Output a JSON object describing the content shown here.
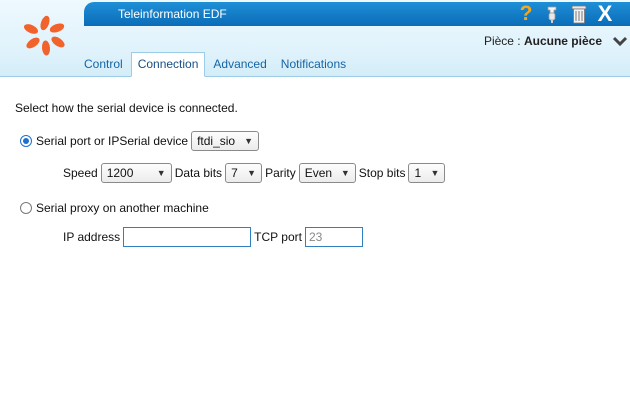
{
  "window": {
    "title": "Teleinformation EDF",
    "icons": [
      "help-icon",
      "plugin-icon",
      "trash-icon",
      "close-icon"
    ],
    "help_glyph": "?",
    "close_glyph": "X"
  },
  "room": {
    "label": "Pièce :",
    "value": "Aucune pièce"
  },
  "tabs": [
    {
      "label": "Control",
      "active": false
    },
    {
      "label": "Connection",
      "active": true
    },
    {
      "label": "Advanced",
      "active": false
    },
    {
      "label": "Notifications",
      "active": false
    }
  ],
  "connection": {
    "intro": "Select how the serial device is connected.",
    "serial": {
      "label": "Serial port or IPSerial device",
      "selected": true,
      "device": "ftdi_sio",
      "speed_label": "Speed",
      "speed": "1200",
      "databits_label": "Data bits",
      "databits": "7",
      "parity_label": "Parity",
      "parity": "Even",
      "stopbits_label": "Stop bits",
      "stopbits": "1"
    },
    "proxy": {
      "label": "Serial proxy on another machine",
      "selected": false,
      "ip_label": "IP address",
      "ip_value": "",
      "port_label": "TCP port",
      "port_placeholder": "23"
    }
  },
  "colors": {
    "accent": "#0b6cb8",
    "logo": "#f2622b",
    "tab_text": "#1565a6"
  }
}
